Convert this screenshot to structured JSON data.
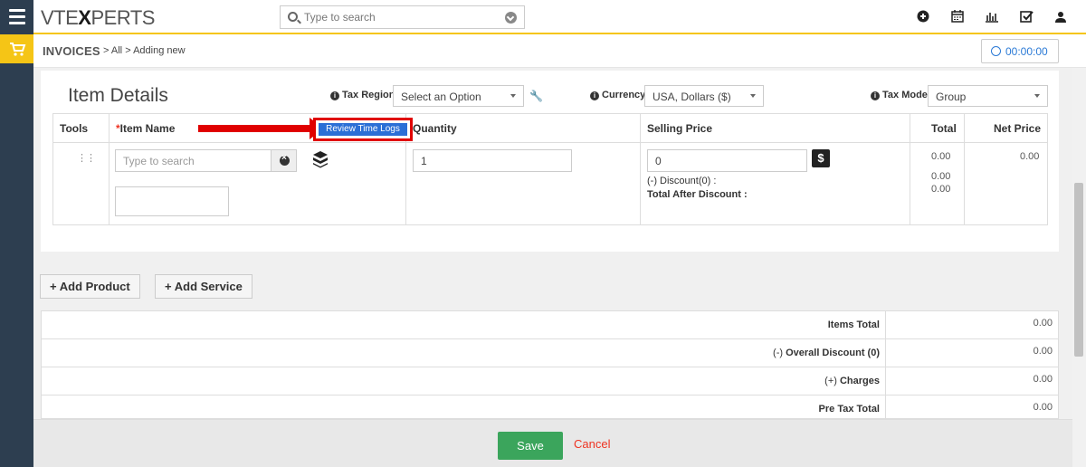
{
  "topbar": {
    "logo_a": "VTE",
    "logo_b": "X",
    "logo_c": "PERTS",
    "search_placeholder": "Type to search",
    "icons": [
      "plus-circle-icon",
      "calendar-icon",
      "chart-icon",
      "checkbox-icon",
      "user-icon"
    ]
  },
  "breadcrumb": {
    "module": "INVOICES",
    "sep1": ">",
    "all": "All",
    "sep2": ">",
    "current": "Adding new",
    "timer": "00:00:00"
  },
  "item_details": {
    "title": "Item Details",
    "tax_region_label": "Tax Region",
    "tax_region_value": "Select an Option",
    "currency_label": "Currency",
    "currency_value": "USA, Dollars ($)",
    "tax_mode_label": "Tax Mode",
    "tax_mode_value": "Group",
    "columns": {
      "tools": "Tools",
      "item_name_req": "*",
      "item_name": "Item Name",
      "review_time_logs": "Review Time Logs",
      "quantity": "Quantity",
      "selling_price": "Selling Price",
      "total": "Total",
      "net_price": "Net Price"
    },
    "row": {
      "item_placeholder": "Type to search",
      "quantity": "1",
      "selling_price": "0",
      "discount": "(-) Discount(0) :",
      "total_after_discount": "Total After Discount :",
      "total": "0.00",
      "discount_value": "0.00",
      "after_discount_value": "0.00",
      "net_price": "0.00"
    }
  },
  "buttons": {
    "add_product": "Add Product",
    "add_service": "Add Service",
    "save": "Save",
    "cancel": "Cancel"
  },
  "totals": [
    {
      "label_prefix": "",
      "label": "Items Total",
      "value": "0.00"
    },
    {
      "label_prefix": "(-) ",
      "label": "Overall Discount (0)",
      "value": "0.00"
    },
    {
      "label_prefix": "(+) ",
      "label": "Charges",
      "value": "0.00"
    },
    {
      "label_prefix": "",
      "label": "Pre Tax Total",
      "value": "0.00"
    }
  ],
  "colors": {
    "accent": "#f5c516",
    "rail": "#2d3e50",
    "save": "#3ba55c",
    "highlight": "#e00000",
    "link": "#2b6fd6"
  }
}
